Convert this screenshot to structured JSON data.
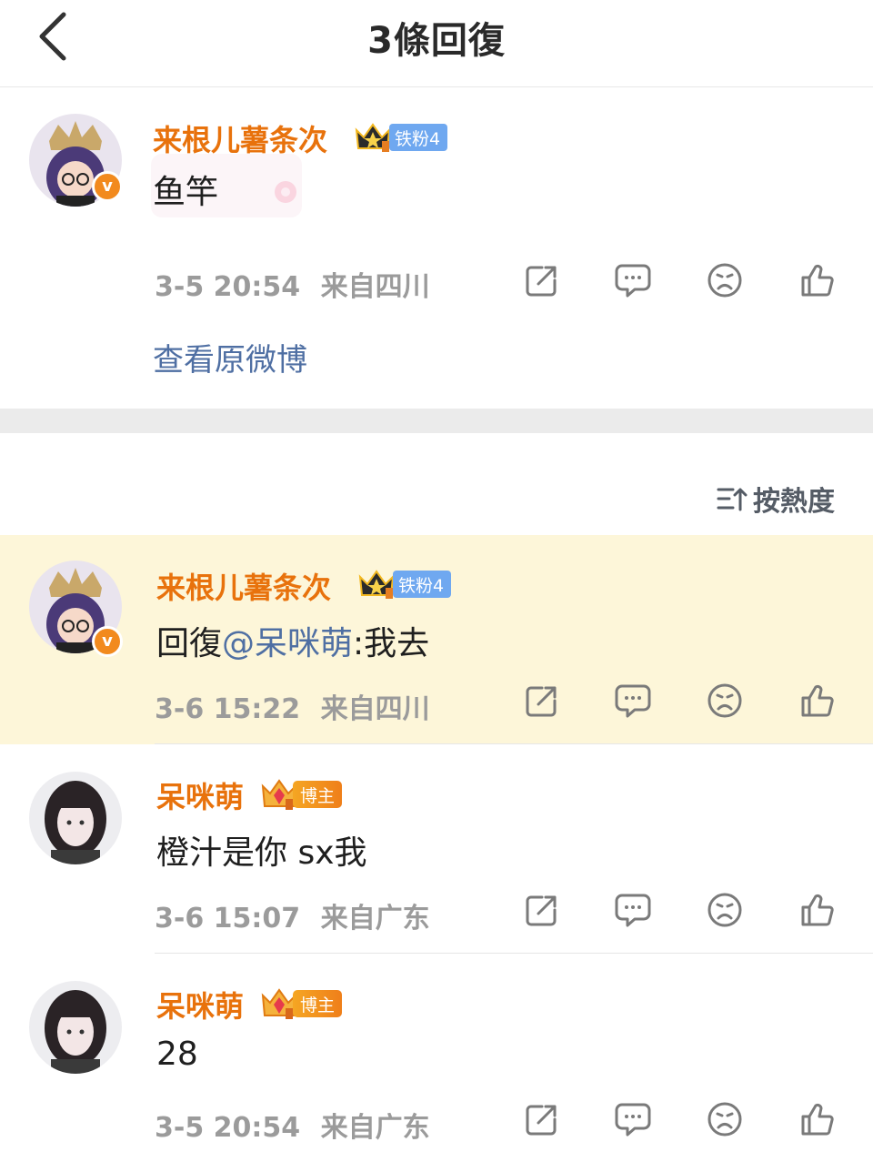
{
  "header": {
    "title": "3條回復",
    "back_icon": "chevron-left-icon"
  },
  "root_comment": {
    "username": "来根儿薯条次",
    "fan_badge": "铁粉4",
    "content": "鱼竿",
    "timestamp": "3-5 20:54",
    "location": "来自四川",
    "view_original": "查看原微博"
  },
  "sort": {
    "label": "按熱度",
    "icon": "sort-icon"
  },
  "replies": [
    {
      "username": "来根儿薯条次",
      "fan_badge": "铁粉4",
      "content_prefix": "回復",
      "mention": "@呆咪萌",
      "content_suffix": ":我去",
      "timestamp": "3-6 15:22",
      "location": "来自四川",
      "highlighted": true
    },
    {
      "username": "呆咪萌",
      "role_badge": "博主",
      "content": "橙汁是你 sx我",
      "timestamp": "3-6 15:07",
      "location": "来自广东"
    },
    {
      "username": "呆咪萌",
      "role_badge": "博主",
      "content": "28",
      "timestamp": "3-5 20:54",
      "location": "来自广东"
    }
  ],
  "action_icons": [
    "share-icon",
    "comment-icon",
    "dislike-icon",
    "like-icon"
  ],
  "colors": {
    "username": "#e8720c",
    "mention": "#4f6fa3",
    "meta": "#9b9b9b",
    "highlight_bg": "#fdf6d9",
    "fan_badge_bg": "#6fa8f0",
    "verified": "#f28a1e"
  }
}
